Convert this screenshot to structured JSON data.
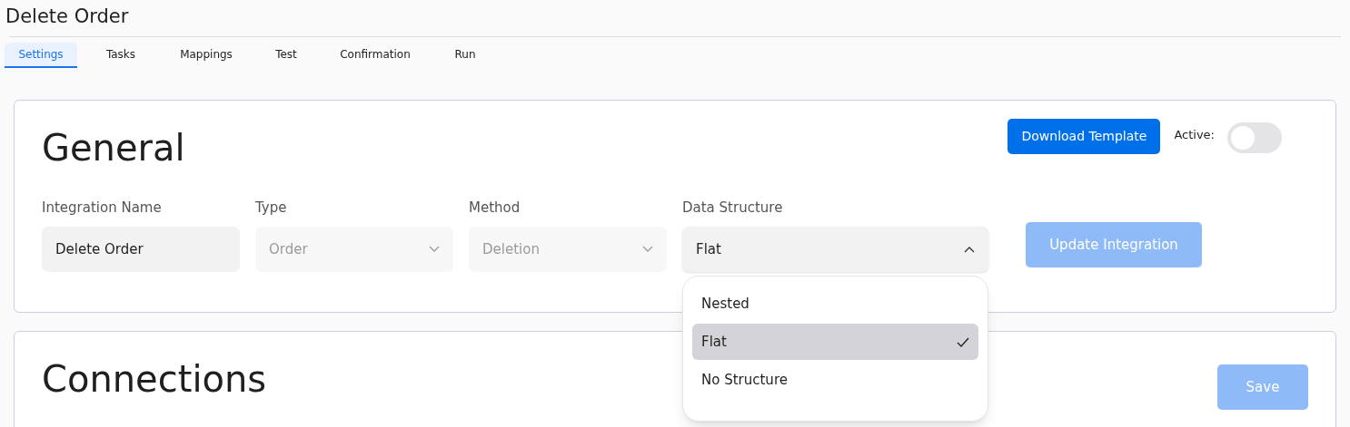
{
  "page": {
    "title": "Delete Order"
  },
  "tabs": [
    {
      "label": "Settings",
      "selected": true
    },
    {
      "label": "Tasks",
      "selected": false
    },
    {
      "label": "Mappings",
      "selected": false
    },
    {
      "label": "Test",
      "selected": false
    },
    {
      "label": "Confirmation",
      "selected": false
    },
    {
      "label": "Run",
      "selected": false
    }
  ],
  "general": {
    "heading": "General",
    "download_button": "Download Template",
    "active_label": "Active:",
    "active_on": false,
    "fields": [
      {
        "kind": "text",
        "label": "Integration Name",
        "value": "Delete Order",
        "disabled": false
      },
      {
        "kind": "select",
        "label": "Type",
        "value": "Order",
        "disabled": true,
        "expanded": false
      },
      {
        "kind": "select",
        "label": "Method",
        "value": "Deletion",
        "disabled": true,
        "expanded": false
      },
      {
        "kind": "select",
        "label": "Data Structure",
        "value": "Flat",
        "disabled": false,
        "expanded": true,
        "options": [
          {
            "label": "Nested",
            "selected": false
          },
          {
            "label": "Flat",
            "selected": true
          },
          {
            "label": "No Structure",
            "selected": false
          }
        ]
      }
    ],
    "update_button": {
      "label": "Update Integration",
      "disabled": true
    }
  },
  "connections": {
    "heading": "Connections",
    "save_button": {
      "label": "Save",
      "disabled": true
    }
  }
}
